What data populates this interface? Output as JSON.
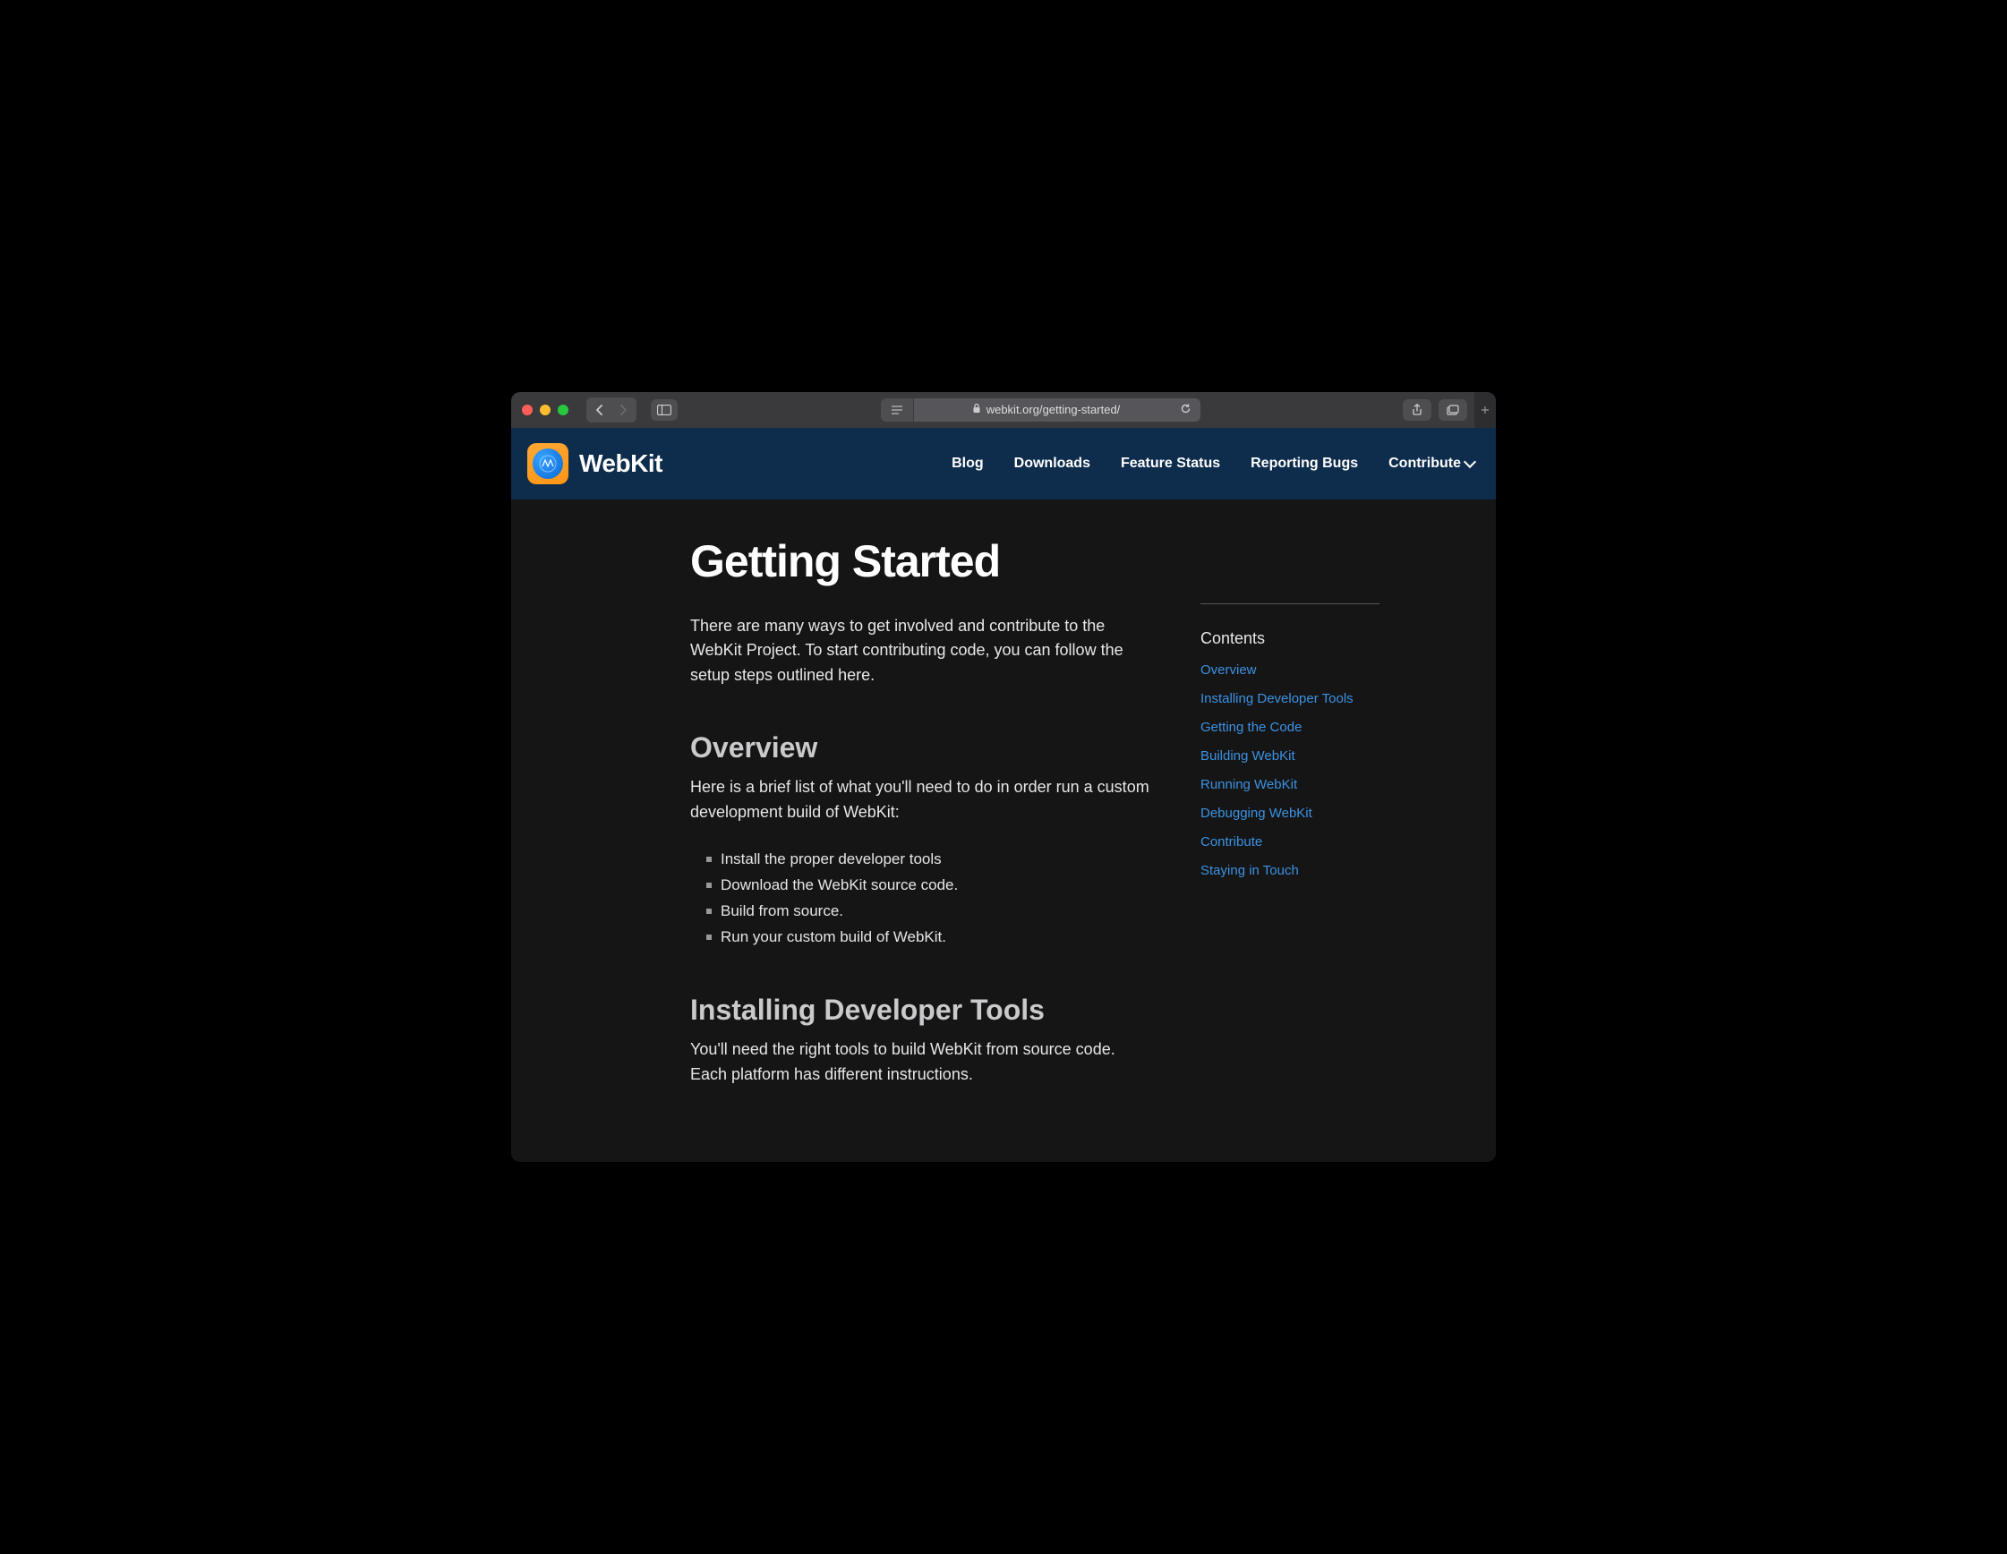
{
  "browser": {
    "url": "webkit.org/getting-started/"
  },
  "nav": {
    "brand": "WebKit",
    "links": [
      "Blog",
      "Downloads",
      "Feature Status",
      "Reporting Bugs",
      "Contribute"
    ]
  },
  "page": {
    "title": "Getting Started",
    "intro": "There are many ways to get involved and contribute to the WebKit Project. To start contributing code, you can follow the setup steps outlined here.",
    "overview": {
      "heading": "Overview",
      "text": "Here is a brief list of what you'll need to do in order run a custom development build of WebKit:",
      "steps": [
        "Install the proper developer tools",
        "Download the WebKit source code.",
        "Build from source.",
        "Run your custom build of WebKit."
      ]
    },
    "installing": {
      "heading": "Installing Developer Tools",
      "text": "You'll need the right tools to build WebKit from source code. Each platform has different instructions."
    }
  },
  "toc": {
    "title": "Contents",
    "items": [
      "Overview",
      "Installing Developer Tools",
      "Getting the Code",
      "Building WebKit",
      "Running WebKit",
      "Debugging WebKit",
      "Contribute",
      "Staying in Touch"
    ]
  }
}
